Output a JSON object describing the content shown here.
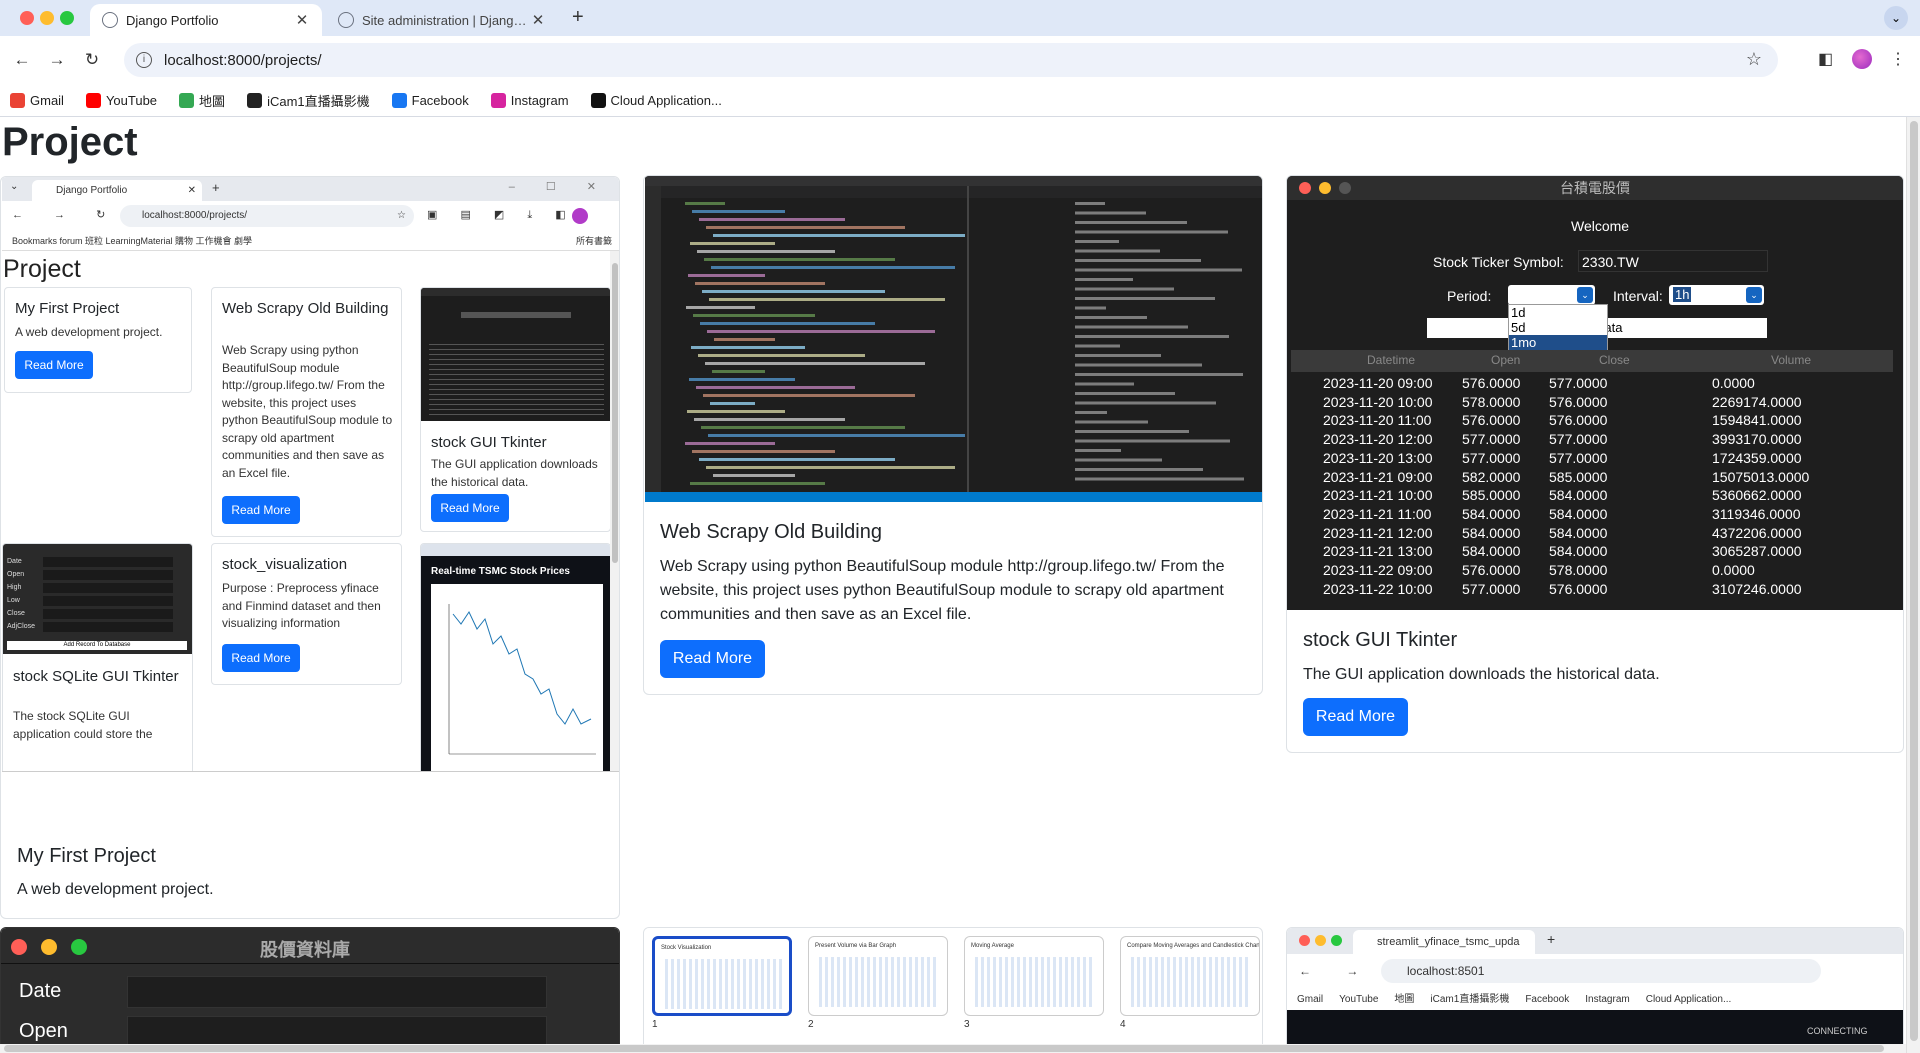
{
  "browser": {
    "tabs": [
      {
        "title": "Django Portfolio",
        "active": true
      },
      {
        "title": "Site administration | Django site admin",
        "active": false
      }
    ],
    "url": "localhost:8000/projects/",
    "bookmarks": [
      {
        "label": "Gmail",
        "icon": "gmail-icon",
        "color": "#ea4335"
      },
      {
        "label": "YouTube",
        "icon": "youtube-icon",
        "color": "#ff0000"
      },
      {
        "label": "地圖",
        "icon": "maps-icon",
        "color": "#34a853"
      },
      {
        "label": "iCam1直播攝影機",
        "icon": "camera-icon",
        "color": "#222222"
      },
      {
        "label": "Facebook",
        "icon": "facebook-icon",
        "color": "#1877f2"
      },
      {
        "label": "Instagram",
        "icon": "instagram-icon",
        "color": "#d6249f"
      },
      {
        "label": "Cloud Application...",
        "icon": "cloud-app-icon",
        "color": "#111111"
      }
    ]
  },
  "page": {
    "title": "Project",
    "read_more": "Read More",
    "projects": [
      {
        "title": "My First Project",
        "description": "A web development project."
      },
      {
        "title": "Web Scrapy Old Building",
        "description": "Web Scrapy using python BeautifulSoup module http://group.lifego.tw/ From the website, this project uses python BeautifulSoup module to scrapy old apartment communities and then save as an Excel file."
      },
      {
        "title": "stock GUI Tkinter",
        "description": "The GUI application downloads the historical data."
      }
    ]
  },
  "mini_browser": {
    "tab": "Django Portfolio",
    "url": "localhost:8000/projects/",
    "bookmarks_bar": "Bookmarks    forum    班粒    LearningMaterial    購物    工作機會    劇學",
    "all_bookmarks": "所有書籤",
    "page_title": "Project",
    "read_more": "Read More",
    "cards": [
      {
        "title": "My First Project",
        "text": "A web development project."
      },
      {
        "title": "Web Scrapy Old Building",
        "text": "Web Scrapy using python BeautifulSoup module http://group.lifego.tw/ From the website, this project uses python BeautifulSoup module to scrapy old apartment communities and then save as an Excel file."
      },
      {
        "title": "stock GUI Tkinter",
        "text": "The GUI application downloads the historical data."
      },
      {
        "title": "stock SQLite GUI Tkinter",
        "text": "The stock SQLite GUI application could store the"
      },
      {
        "title": "stock_visualization",
        "text": "Purpose : Preprocess yfinace and Finmind dataset and then visualizing information"
      }
    ],
    "tsmc_title": "Real-time TSMC Stock Prices",
    "db_fields": [
      "Date",
      "Open",
      "High",
      "Low",
      "Close",
      "AdjClose"
    ],
    "db_button": "Add Record To Database"
  },
  "tk_app": {
    "window_title": "台積電股價",
    "welcome": "Welcome",
    "ticker_label": "Stock Ticker Symbol:",
    "ticker_value": "2330.TW",
    "period_label": "Period:",
    "interval_label": "Interval:",
    "interval_value": "1h",
    "period_options": [
      "1d",
      "5d",
      "1mo"
    ],
    "selected_option": "1mo",
    "data_button": "Data",
    "columns": [
      "Datetime",
      "Open",
      "Close",
      "Volume"
    ],
    "rows": [
      [
        "2023-11-20 09:00",
        "576.0000",
        "577.0000",
        "0.0000"
      ],
      [
        "2023-11-20 10:00",
        "578.0000",
        "576.0000",
        "2269174.0000"
      ],
      [
        "2023-11-20 11:00",
        "576.0000",
        "576.0000",
        "1594841.0000"
      ],
      [
        "2023-11-20 12:00",
        "577.0000",
        "577.0000",
        "3993170.0000"
      ],
      [
        "2023-11-20 13:00",
        "577.0000",
        "577.0000",
        "1724359.0000"
      ],
      [
        "2023-11-21 09:00",
        "582.0000",
        "585.0000",
        "15075013.0000"
      ],
      [
        "2023-11-21 10:00",
        "585.0000",
        "584.0000",
        "5360662.0000"
      ],
      [
        "2023-11-21 11:00",
        "584.0000",
        "584.0000",
        "3119346.0000"
      ],
      [
        "2023-11-21 12:00",
        "584.0000",
        "584.0000",
        "4372206.0000"
      ],
      [
        "2023-11-21 13:00",
        "584.0000",
        "584.0000",
        "3065287.0000"
      ],
      [
        "2023-11-22 09:00",
        "576.0000",
        "578.0000",
        "0.0000"
      ],
      [
        "2023-11-22 10:00",
        "577.0000",
        "576.0000",
        "3107246.0000"
      ]
    ]
  },
  "bottom": {
    "db_app_title": "股價資料庫",
    "db_fields": [
      "Date",
      "Open"
    ],
    "chart_thumbs": [
      {
        "caption": "Stock Visualization",
        "num": "1"
      },
      {
        "caption": "Present Volume via Bar Graph",
        "num": "2"
      },
      {
        "caption": "Moving Average",
        "num": "3"
      },
      {
        "caption": "Compare Moving Averages and Candlestick Chart",
        "num": "4"
      }
    ],
    "streamlit": {
      "tab": "streamlit_yfinace_tsmc_upda",
      "url": "localhost:8501",
      "bookmarks": [
        "Gmail",
        "YouTube",
        "地圖",
        "iCam1直播攝影機",
        "Facebook",
        "Instagram",
        "Cloud Application..."
      ],
      "status": "CONNECTING"
    }
  }
}
